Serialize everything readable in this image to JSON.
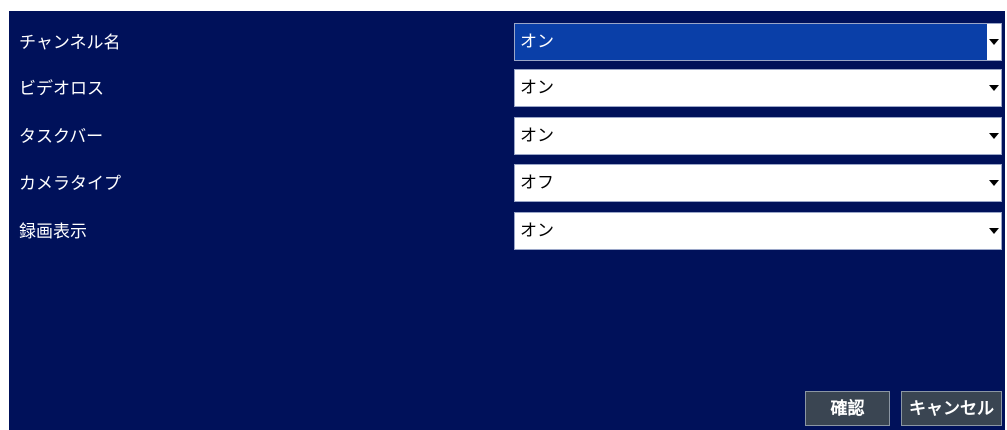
{
  "settings": [
    {
      "label": "チャンネル名",
      "value": "オン"
    },
    {
      "label": "ビデオロス",
      "value": "オン"
    },
    {
      "label": "タスクバー",
      "value": "オン"
    },
    {
      "label": "カメラタイプ",
      "value": "オフ"
    },
    {
      "label": "録画表示",
      "value": "オン"
    }
  ],
  "buttons": {
    "confirm": "確認",
    "cancel": "キャンセル"
  },
  "colors": {
    "panel_background": "#00115a",
    "active_select": "#0a3fa8",
    "button_background": "#3a4552"
  }
}
